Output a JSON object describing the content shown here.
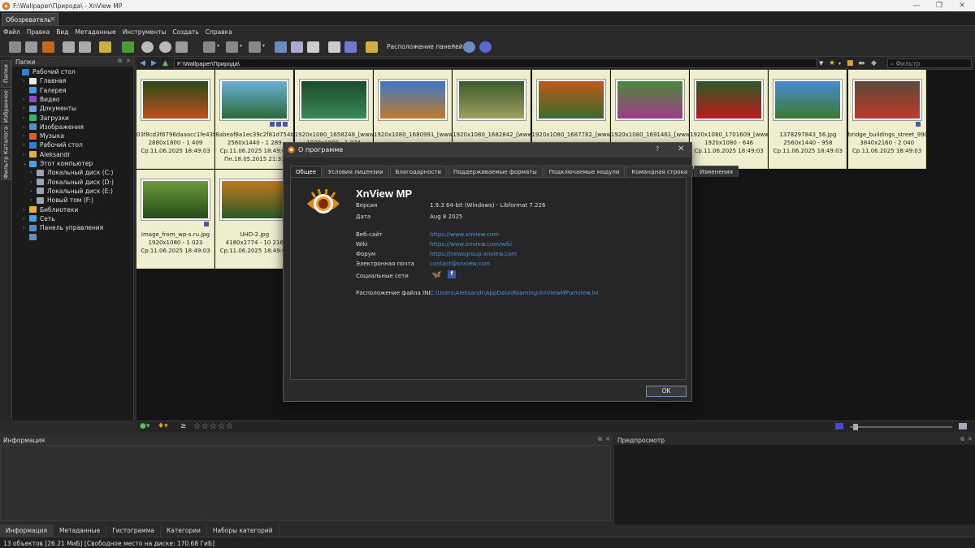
{
  "window": {
    "title": "F:\\Wallpaper\\Природа\\ - XnView MP",
    "minimize": "—",
    "maximize": "❐",
    "close": "✕"
  },
  "tab": {
    "label": "Обозреватель",
    "close": "✕"
  },
  "menu": [
    "Файл",
    "Правка",
    "Вид",
    "Метаданные",
    "Инструменты",
    "Создать",
    "Справка"
  ],
  "toolbar": {
    "layout_label": "Расположение панелей"
  },
  "left_tabs": [
    "Папки",
    "Избранное",
    "Фильтр Каталога"
  ],
  "folders": {
    "title": "Папки",
    "items": [
      {
        "label": "Рабочий стол",
        "level": 0,
        "exp": "",
        "color": "#2f7fd8"
      },
      {
        "label": "Главная",
        "level": 1,
        "exp": "›",
        "color": "#e8e8e8"
      },
      {
        "label": "Галерея",
        "level": 1,
        "exp": "",
        "color": "#3fa0e0"
      },
      {
        "label": "Видео",
        "level": 1,
        "exp": "›",
        "color": "#8a4ad0"
      },
      {
        "label": "Документы",
        "level": 1,
        "exp": "›",
        "color": "#6aa0d8"
      },
      {
        "label": "Загрузки",
        "level": 1,
        "exp": "›",
        "color": "#3ab06a"
      },
      {
        "label": "Изображения",
        "level": 1,
        "exp": "›",
        "color": "#4d8fd0"
      },
      {
        "label": "Музыка",
        "level": 1,
        "exp": "›",
        "color": "#e05a3a"
      },
      {
        "label": "Рабочий стол",
        "level": 1,
        "exp": "›",
        "color": "#2f7fd8"
      },
      {
        "label": "Aleksandr",
        "level": 1,
        "exp": "›",
        "color": "#e0b040"
      },
      {
        "label": "Этот компьютер",
        "level": 1,
        "exp": "⌄",
        "color": "#4aa0e0"
      },
      {
        "label": "Локальный диск (C:)",
        "level": 2,
        "exp": "›",
        "color": "#9aa4b0"
      },
      {
        "label": "Локальный диск (D:)",
        "level": 2,
        "exp": "›",
        "color": "#9aa4b0"
      },
      {
        "label": "Локальный диск (E:)",
        "level": 2,
        "exp": "›",
        "color": "#9aa4b0"
      },
      {
        "label": "Новый том (F:)",
        "level": 2,
        "exp": "›",
        "color": "#9aa4b0"
      },
      {
        "label": "Библиотеки",
        "level": 1,
        "exp": "›",
        "color": "#e0b040"
      },
      {
        "label": "Сеть",
        "level": 1,
        "exp": "›",
        "color": "#4aa0e0"
      },
      {
        "label": "Панель управления",
        "level": 1,
        "exp": "›",
        "color": "#4a90d0"
      },
      {
        "label": "",
        "level": 1,
        "exp": "",
        "color": "#6a8ab0"
      }
    ]
  },
  "path": {
    "value": "F:\\Wallpaper\\Природа\\",
    "filter_placeholder": "Фильтр"
  },
  "thumbnails": [
    {
      "name": "03f8cd3f6796daaacc1fe43ff...",
      "dims": "2880x1800 - 1 409",
      "date": "Ср.11.06.2025 18:49:03",
      "extra": "",
      "c1": "#2a4a1a",
      "c2": "#c0501a",
      "badges": 0
    },
    {
      "name": "8abeaf8a1ec39c2f81d754b8...",
      "dims": "2560x1440 - 1 289",
      "date": "Ср.11.06.2025 18:49:03",
      "extra": "Пн.18.05.2015 21:33",
      "c1": "#6ab0d8",
      "c2": "#2a6a3a",
      "badges": 3
    },
    {
      "name": "1920x1080_1658248_[www...",
      "dims": "1920x1080 - 1 074",
      "date": "",
      "extra": "",
      "c1": "#1a4a2a",
      "c2": "#3a8a5a",
      "badges": 0
    },
    {
      "name": "1920x1080_1680991_[www...",
      "dims": "",
      "date": "",
      "extra": "",
      "c1": "#3a7ac8",
      "c2": "#c07a2a",
      "badges": 0
    },
    {
      "name": "1920x1080_1682842_[www...",
      "dims": "",
      "date": "",
      "extra": "",
      "c1": "#3a5a2a",
      "c2": "#a0a060",
      "badges": 0
    },
    {
      "name": "1920x1080_1687782_[www...",
      "dims": "",
      "date": "",
      "extra": "",
      "c1": "#c05a1a",
      "c2": "#3a6a2a",
      "badges": 0
    },
    {
      "name": "1920x1080_1691461_[www...",
      "dims": "",
      "date": "",
      "extra": "",
      "c1": "#4a8a3a",
      "c2": "#a03a8a",
      "badges": 0
    },
    {
      "name": "1920x1080_1701609_[www...",
      "dims": "1920x1080 - 646",
      "date": "Ср.11.06.2025 18:49:03",
      "extra": "",
      "c1": "#2a5a2a",
      "c2": "#c01a1a",
      "badges": 0
    },
    {
      "name": "1378297843_56.jpg",
      "dims": "2560x1440 - 958",
      "date": "Ср.11.06.2025 18:49:03",
      "extra": "",
      "c1": "#4a8ad8",
      "c2": "#3a7a2a",
      "badges": 0
    },
    {
      "name": "bridge_buildings_street_990...",
      "dims": "3840x2160 - 2 040",
      "date": "Ср.11.06.2025 18:49:03",
      "extra": "",
      "c1": "#5a4a3a",
      "c2": "#c03a2a",
      "badges": 1
    },
    {
      "name": "Image_from_wp-s.ru.jpg",
      "dims": "1920x1080 - 1 023",
      "date": "Ср.11.06.2025 18:49:03",
      "extra": "",
      "c1": "#6a9a3a",
      "c2": "#2a4a1a",
      "badges": 1
    },
    {
      "name": "UHD-2.jpg",
      "dims": "4180x2774 - 10 216",
      "date": "Ср.11.06.2025 18:49:03",
      "extra": "",
      "c1": "#c07a1a",
      "c2": "#2a5a2a",
      "badges": 0
    }
  ],
  "rating_stars": "☆☆☆☆☆",
  "rating_op": "≥",
  "info_panel": {
    "title": "Информация"
  },
  "preview_panel": {
    "title": "Предпросмотр"
  },
  "bottom_tabs": [
    "Информация",
    "Метаданные",
    "Гистограмма",
    "Категории",
    "Наборы категорий"
  ],
  "status": "13 объектов [26.21 МиБ] [Свободное место на диске: 170.68 ГиБ]",
  "dialog": {
    "title": "О программе",
    "help": "?",
    "close": "✕",
    "tabs": [
      "Общее",
      "Условия лицензии",
      "Благодарности",
      "Поддерживаемые форматы",
      "Подключаемые модули",
      "Командная строка",
      "Изменения"
    ],
    "app_name": "XnView MP",
    "version_label": "Версия",
    "version_value": "1.9.3 64-bit (Windows) - Libformat 7.226",
    "date_label": "Дата",
    "date_value": "Aug  8 2025",
    "website_label": "Веб-сайт",
    "website_value": "https://www.xnview.com",
    "wiki_label": "Wiki",
    "wiki_value": "https://www.xnview.com/wiki",
    "forum_label": "Форум",
    "forum_value": "https://newsgroup.xnview.com",
    "email_label": "Электронная почта",
    "email_value": "contact@xnview.com",
    "social_label": "Социальные сети",
    "ini_label": "Расположение файла INI",
    "ini_value": "C:\\Users\\Aleksandr\\AppData\\Roaming\\XnViewMP\\xnview.ini",
    "ok": "OK"
  }
}
